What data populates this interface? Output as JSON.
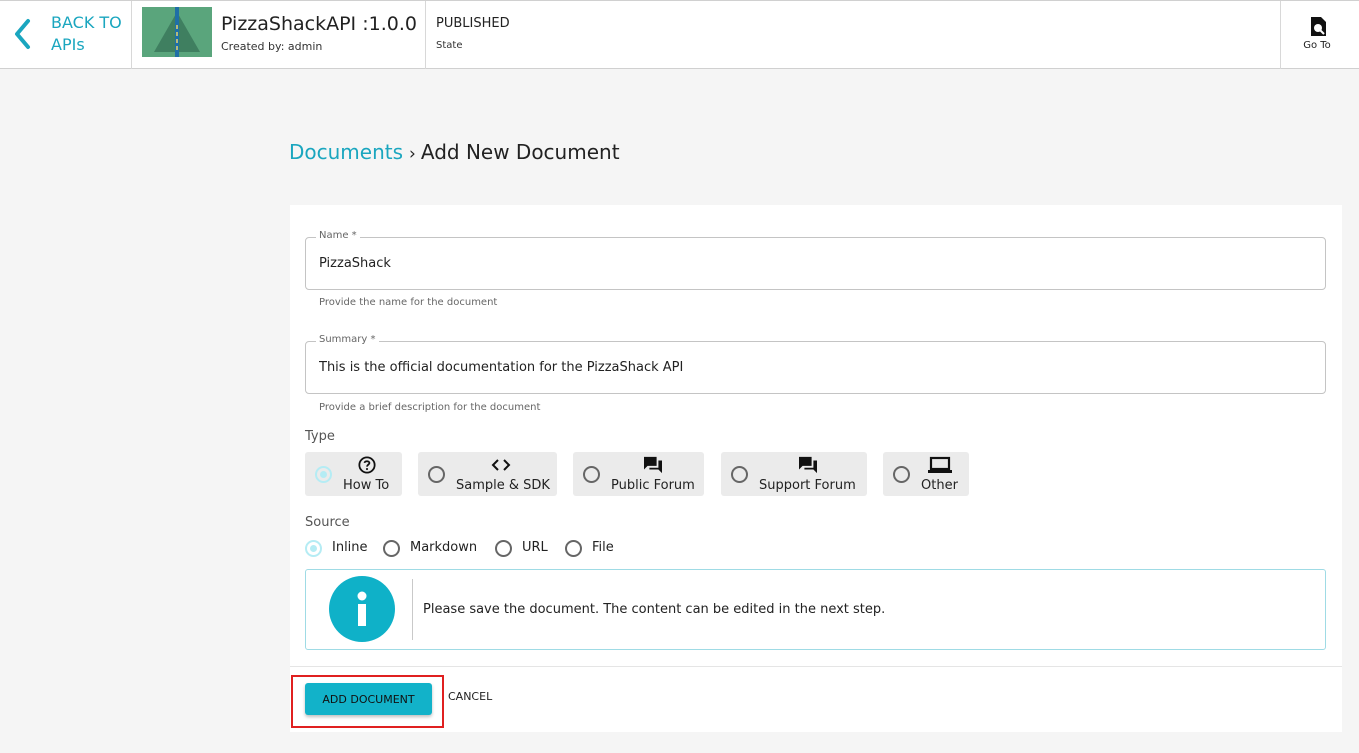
{
  "header": {
    "back_label": "BACK TO APIs",
    "api_title": "PizzaShackAPI :1.0.0",
    "created_by": "Created by: admin",
    "state_value": "PUBLISHED",
    "state_label": "State",
    "goto_label": "Go To"
  },
  "breadcrumb": {
    "parent": "Documents",
    "separator": "›",
    "current": "Add New Document"
  },
  "form": {
    "name": {
      "label": "Name *",
      "value": "PizzaShack",
      "helper": "Provide the name for the document"
    },
    "summary": {
      "label": "Summary *",
      "value": "This is the official documentation for the PizzaShack API",
      "helper": "Provide a brief description for the document"
    },
    "type_label": "Type",
    "types": [
      {
        "label": "How To",
        "icon": "help-circle-icon",
        "selected": true
      },
      {
        "label": "Sample & SDK",
        "icon": "code-icon",
        "selected": false
      },
      {
        "label": "Public Forum",
        "icon": "forum-icon",
        "selected": false
      },
      {
        "label": "Support Forum",
        "icon": "forum-icon",
        "selected": false
      },
      {
        "label": "Other",
        "icon": "laptop-icon",
        "selected": false
      }
    ],
    "source_label": "Source",
    "sources": [
      {
        "label": "Inline",
        "selected": true
      },
      {
        "label": "Markdown",
        "selected": false
      },
      {
        "label": "URL",
        "selected": false
      },
      {
        "label": "File",
        "selected": false
      }
    ],
    "info_message": "Please save the document. The content can be edited in the next step.",
    "add_button": "ADD DOCUMENT",
    "cancel_button": "CANCEL"
  },
  "colors": {
    "accent": "#1aa6bf",
    "button": "#12b2c9",
    "highlight": "#e02020"
  }
}
